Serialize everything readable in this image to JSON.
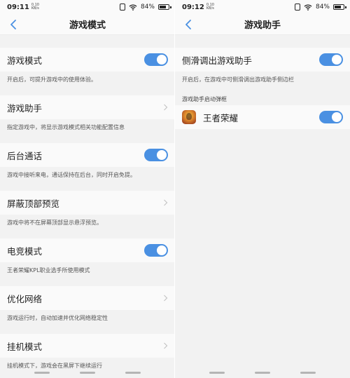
{
  "left": {
    "status": {
      "time": "09:11",
      "speed_value": "0.10",
      "speed_unit": "KB/s",
      "battery": "84%"
    },
    "title": "游戏模式",
    "settings": [
      {
        "label": "游戏模式",
        "desc": "开启后，可提升游戏中的使用体验。",
        "control": "toggle",
        "on": true
      },
      {
        "label": "游戏助手",
        "desc": "指定游戏中，将显示游戏模式相关功能配置信息",
        "control": "chevron"
      },
      {
        "label": "后台通话",
        "desc": "游戏中接听来电，通话保持在后台，同时开启免提。",
        "control": "toggle",
        "on": true
      },
      {
        "label": "屏蔽顶部预览",
        "desc": "游戏中将不在屏幕顶部显示悬浮预览。",
        "control": "chevron"
      },
      {
        "label": "电竞模式",
        "desc": "王者荣耀KPL职业选手所使用模式",
        "control": "toggle",
        "on": true
      },
      {
        "label": "优化网络",
        "desc": "游戏运行时，自动加速并优化网络稳定性",
        "control": "chevron"
      },
      {
        "label": "挂机模式",
        "desc": "挂机模式下，游戏会在黑屏下继续运行",
        "control": "chevron"
      }
    ]
  },
  "right": {
    "status": {
      "time": "09:12",
      "speed_value": "0.10",
      "speed_unit": "KB/s",
      "battery": "84%"
    },
    "title": "游戏助手",
    "slide_label": "侧滑调出游戏助手",
    "slide_desc": "开启后，在游戏中可侧滑调出游戏助手侧边栏",
    "popup_section": "游戏助手启动弹框",
    "app_name": "王者荣耀"
  },
  "colors": {
    "accent": "#4a90e2",
    "row_bg": "#fafafa",
    "page_bg": "#f2f2f2"
  },
  "icons": [
    "back-icon",
    "vibrate-icon",
    "wifi-icon",
    "battery-icon",
    "chevron-right-icon",
    "app-icon"
  ]
}
